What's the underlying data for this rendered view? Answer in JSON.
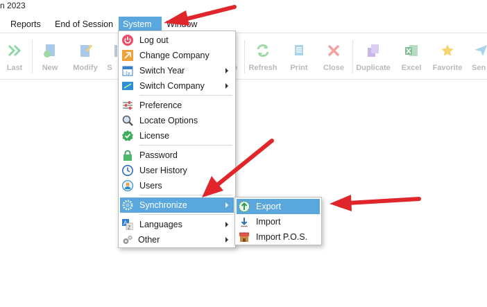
{
  "window": {
    "title_fragment": "n 2023"
  },
  "menubar": {
    "reports": "Reports",
    "end_of_session": "End of Session",
    "system": "System",
    "window": "Window"
  },
  "toolbar": {
    "last": "Last",
    "new": "New",
    "modify": "Modify",
    "s_partial": "S",
    "e_partial": "e",
    "refresh": "Refresh",
    "print": "Print",
    "close": "Close",
    "duplicate": "Duplicate",
    "excel": "Excel",
    "favorite": "Favorite",
    "send_partial": "Sen"
  },
  "system_menu": {
    "log_out": "Log out",
    "change_company": "Change Company",
    "switch_year": "Switch Year",
    "switch_company": "Switch Company",
    "preference": "Preference",
    "locate_options": "Locate Options",
    "license": "License",
    "password": "Password",
    "user_history": "User History",
    "users": "Users",
    "synchronize": "Synchronize",
    "languages": "Languages",
    "other": "Other"
  },
  "sync_submenu": {
    "export": "Export",
    "import": "Import",
    "import_pos": "Import P.O.S."
  },
  "colors": {
    "highlight": "#5aa7de",
    "arrow": "#e0262a",
    "disabled_text": "#b9b9b9"
  }
}
